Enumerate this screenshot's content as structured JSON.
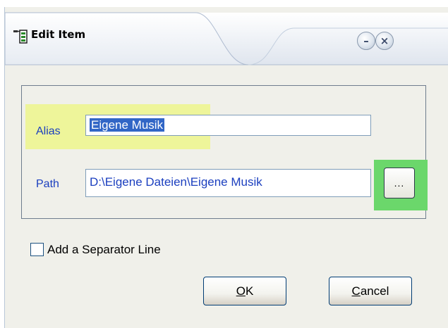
{
  "window": {
    "title": "Edit Item",
    "minimize_glyph": "–",
    "close_glyph": "×"
  },
  "form": {
    "alias_label": "Alias",
    "alias_value": "Eigene Musik",
    "path_label": "Path",
    "path_value": "D:\\Eigene Dateien\\Eigene Musik",
    "browse_label": "..."
  },
  "checkbox": {
    "label": "Add a Separator Line",
    "checked": false
  },
  "buttons": {
    "ok_mnemonic": "O",
    "ok_rest": "K",
    "cancel_mnemonic": "C",
    "cancel_rest": "ancel"
  },
  "colors": {
    "alias_highlight": "#eef59a",
    "browse_highlight": "#6bd76b",
    "label_blue": "#1b3fbf",
    "selection": "#3166c6"
  },
  "icons": {
    "title": "tree-items-icon"
  }
}
